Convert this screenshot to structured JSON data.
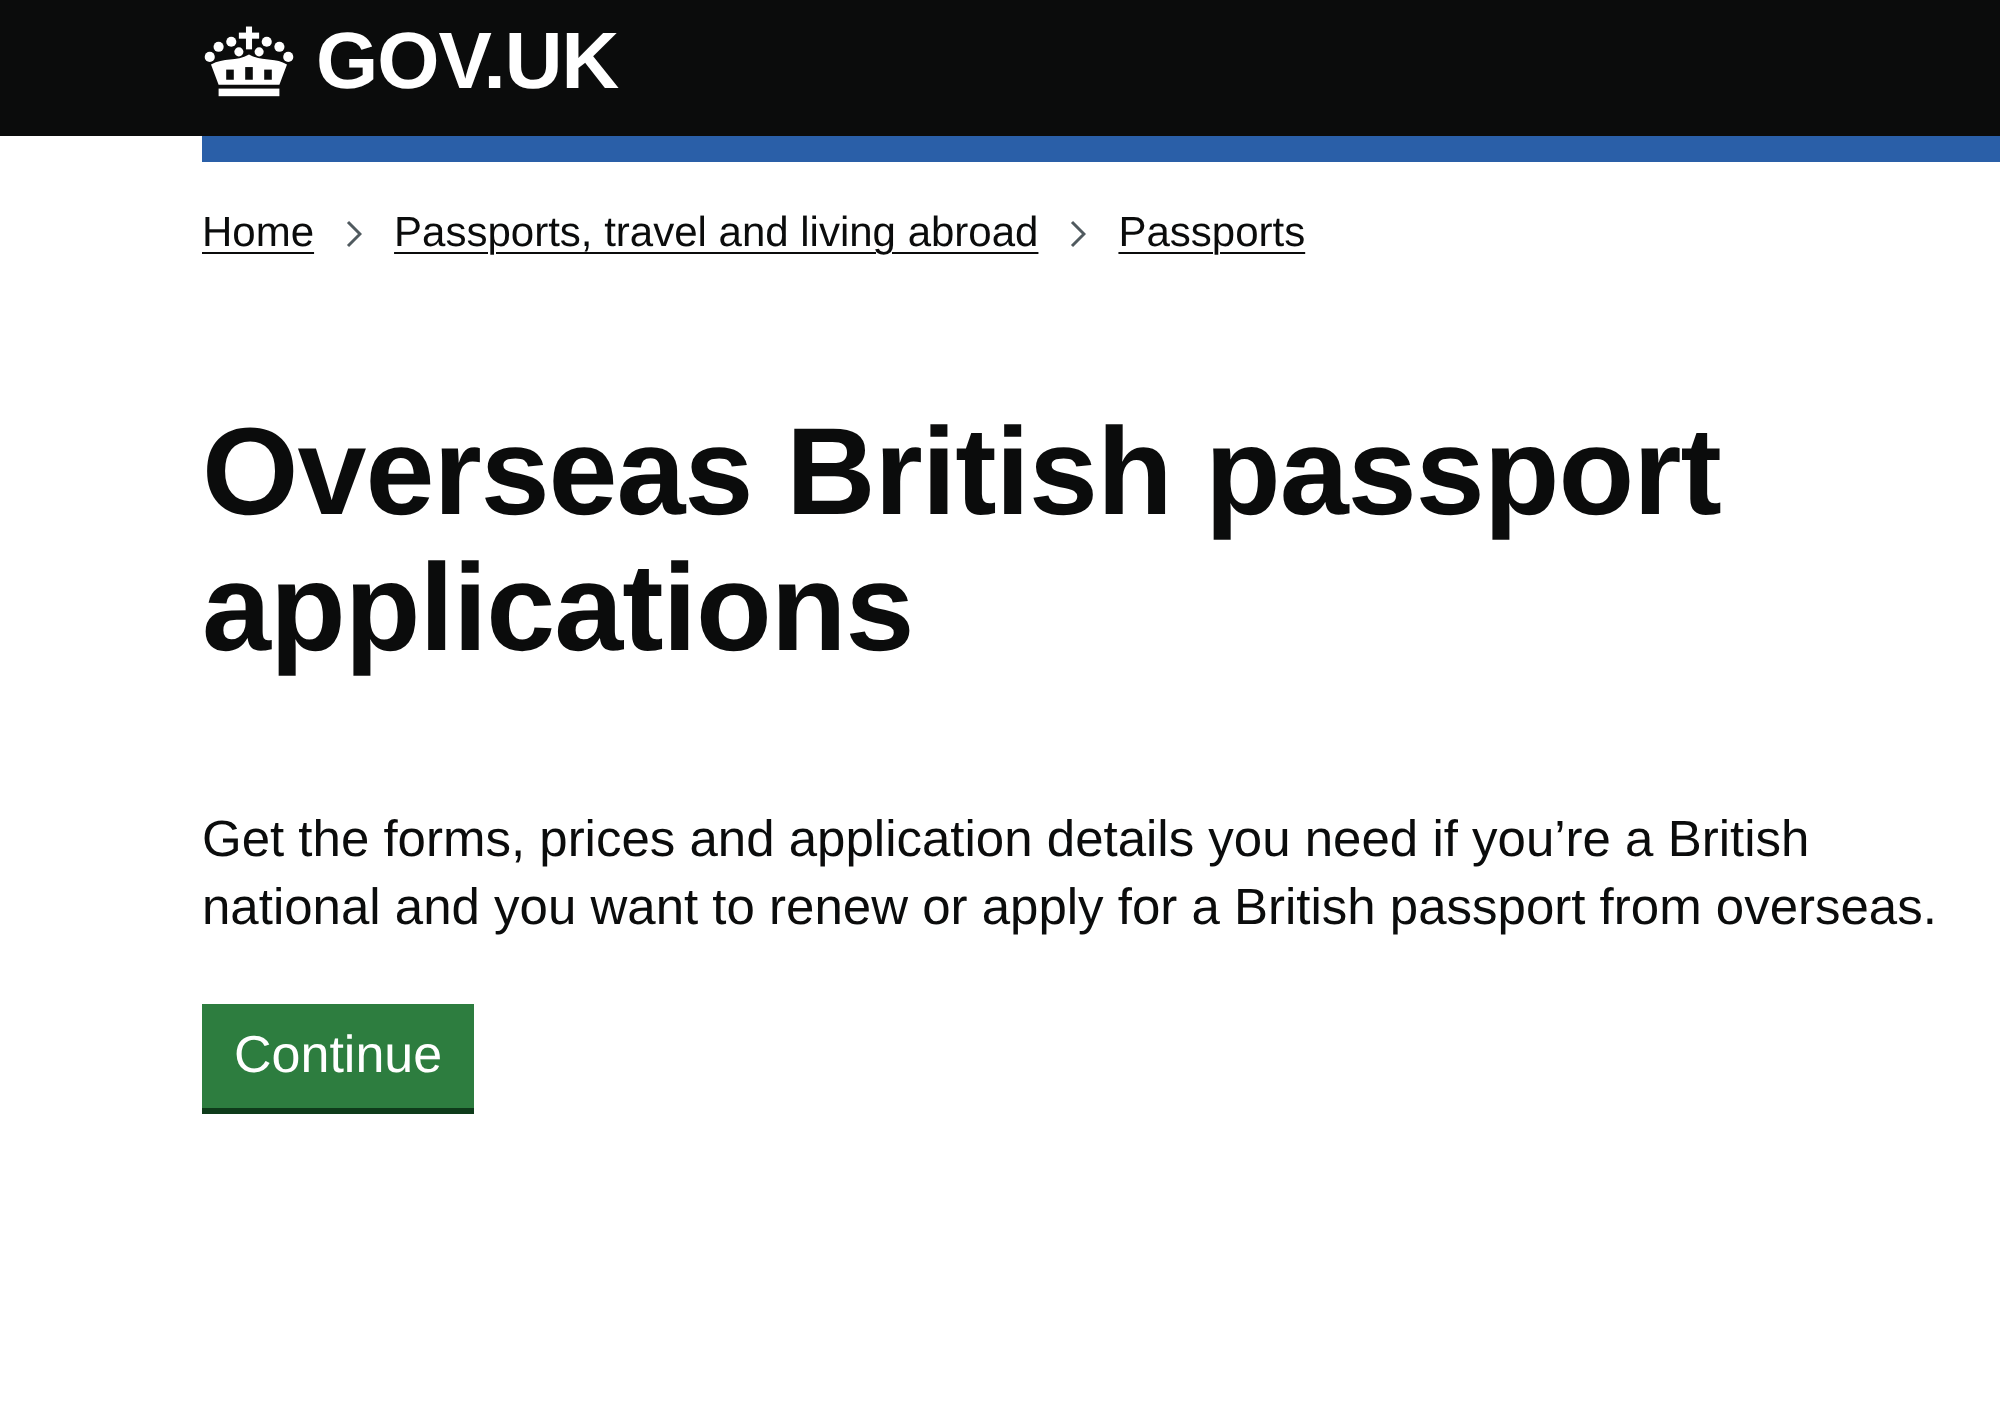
{
  "header": {
    "logo_text": "GOV.UK"
  },
  "breadcrumbs": [
    {
      "label": "Home"
    },
    {
      "label": "Passports, travel and living abroad"
    },
    {
      "label": "Passports"
    }
  ],
  "title": "Overseas British passport applications",
  "description": "Get the forms, prices and application details you need if you’re a British national and you want to renew or apply for a British passport from overseas.",
  "button": {
    "label": "Continue"
  }
}
